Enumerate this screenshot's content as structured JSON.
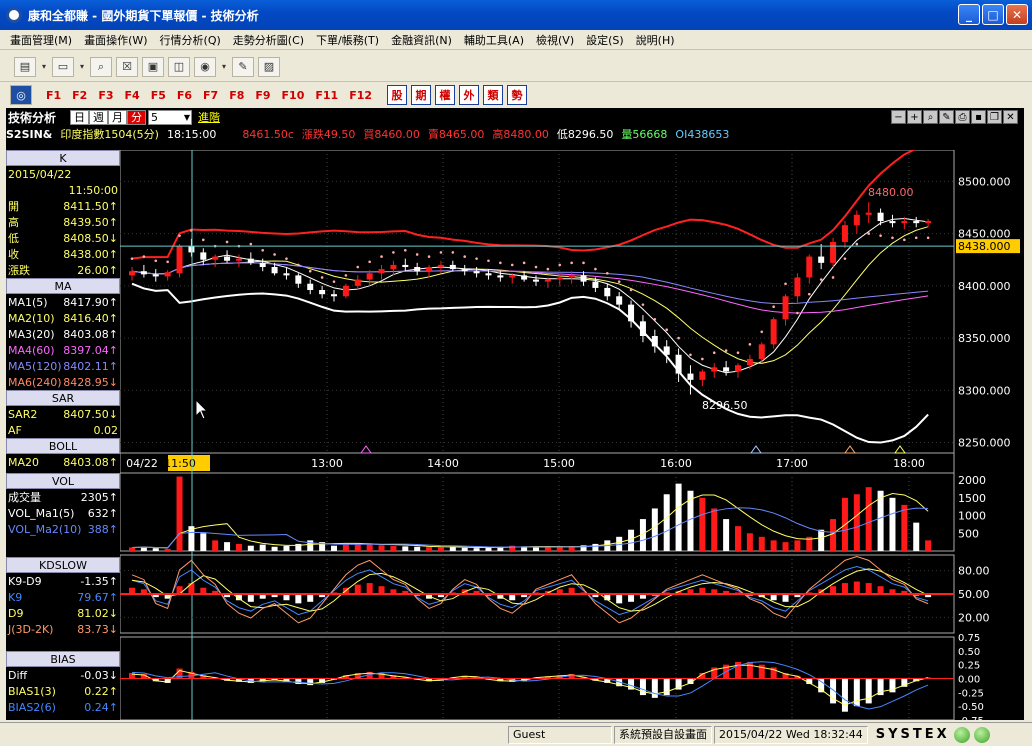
{
  "window": {
    "title": "康和全都賺 - 國外期貨下單報價 - 技術分析",
    "min": "_",
    "max": "□",
    "close": "✕"
  },
  "menu": [
    "畫面管理(M)",
    "畫面操作(W)",
    "行情分析(Q)",
    "走勢分析圖(C)",
    "下單/帳務(T)",
    "金融資訊(N)",
    "輔助工具(A)",
    "檢視(V)",
    "設定(S)",
    "說明(H)"
  ],
  "fkeys": [
    "F1",
    "F2",
    "F3",
    "F4",
    "F5",
    "F6",
    "F7",
    "F8",
    "F9",
    "F10",
    "F11",
    "F12"
  ],
  "categories": [
    "股",
    "期",
    "權",
    "外",
    "類",
    "勢"
  ],
  "chart_header": {
    "title": "技術分析",
    "periods": [
      "日",
      "週",
      "月",
      "分"
    ],
    "selected_period": "分",
    "interval": "5",
    "advanced": "進階"
  },
  "quote": {
    "symbol": "S2SIN&",
    "name": "印度指數1504(5分)",
    "time": "18:15:00",
    "last": "8461.50c",
    "change": "漲跌49.50",
    "bid": "買8460.00",
    "ask": "賣8465.00",
    "high": "高8480.00",
    "low": "低8296.50",
    "volume": "量56668",
    "oi": "OI438653"
  },
  "left": {
    "k": {
      "label": "K",
      "date": "2015/04/22",
      "time": "11:50:00",
      "rows": [
        {
          "n": "開",
          "v": "8411.50↑"
        },
        {
          "n": "高",
          "v": "8439.50↑"
        },
        {
          "n": "低",
          "v": "8408.50↓"
        },
        {
          "n": "收",
          "v": "8438.00↑"
        },
        {
          "n": "漲跌",
          "v": "26.00↑"
        }
      ]
    },
    "ma": {
      "label": "MA",
      "rows": [
        {
          "n": "MA1(5)",
          "v": "8417.90↑",
          "c": "#ffffff"
        },
        {
          "n": "MA2(10)",
          "v": "8416.40↑",
          "c": "#ffff66"
        },
        {
          "n": "MA3(20)",
          "v": "8403.08↑",
          "c": "#ffffff"
        },
        {
          "n": "MA4(60)",
          "v": "8397.04↑",
          "c": "#ff66ff"
        },
        {
          "n": "MA5(120)",
          "v": "8402.11↑",
          "c": "#8888ff"
        },
        {
          "n": "MA6(240)",
          "v": "8428.95↓",
          "c": "#ff8866"
        }
      ]
    },
    "sar": {
      "label": "SAR",
      "rows": [
        {
          "n": "SAR2",
          "v": "8407.50↓"
        },
        {
          "n": "AF",
          "v": "0.02"
        }
      ]
    },
    "boll": {
      "label": "BOLL",
      "rows": [
        {
          "n": "MA20",
          "v": "8403.08↑"
        }
      ]
    },
    "vol": {
      "label": "VOL",
      "rows": [
        {
          "n": "成交量",
          "v": "2305↑",
          "c": "#ffffff"
        },
        {
          "n": "VOL_Ma1(5)",
          "v": "632↑",
          "c": "#ffffff"
        },
        {
          "n": "VOL_Ma2(10)",
          "v": "388↑",
          "c": "#6688ff"
        }
      ]
    },
    "kd": {
      "label": "KDSLOW",
      "rows": [
        {
          "n": "K9-D9",
          "v": "-1.35↑",
          "c": "#ffffff"
        },
        {
          "n": "K9",
          "v": "79.67↑",
          "c": "#4488ff"
        },
        {
          "n": "D9",
          "v": "81.02↓",
          "c": "#ffff66"
        },
        {
          "n": "J(3D-2K)",
          "v": "83.73↓",
          "c": "#ff9966"
        }
      ]
    },
    "bias": {
      "label": "BIAS",
      "rows": [
        {
          "n": "Diff",
          "v": "-0.03↓",
          "c": "#ffffff"
        },
        {
          "n": "BIAS1(3)",
          "v": "0.22↑",
          "c": "#ffff66"
        },
        {
          "n": "BIAS2(6)",
          "v": "0.24↑",
          "c": "#4488ff"
        }
      ]
    }
  },
  "price_axis": [
    "8500.000",
    "8450.000",
    "8400.000",
    "8350.000",
    "8300.000",
    "8250.000"
  ],
  "price_current": "8438.000",
  "time_axis": [
    "04/22",
    "11:50",
    "13:00",
    "14:00",
    "15:00",
    "16:00",
    "17:00",
    "18:00"
  ],
  "annotations": {
    "high": "8480.00",
    "low": "8296.50"
  },
  "vol_axis": [
    "2000",
    "1500",
    "1000",
    "500"
  ],
  "kd_axis": [
    "80.00",
    "50.00",
    "20.00"
  ],
  "bias_axis": [
    "0.75",
    "0.50",
    "0.25",
    "0.00",
    "-0.25",
    "-0.50",
    "-0.75"
  ],
  "status": {
    "user": "Guest",
    "layout": "系統預設自設畫面",
    "datetime": "2015/04/22 Wed 18:32:44",
    "brand": "SYSTEX"
  },
  "colors": {
    "up": "#ff1a1a",
    "down": "#ffffff",
    "bg": "#000000",
    "grid": "#555555",
    "accent": "#ffcc00"
  },
  "chart_data": [
    {
      "type": "candlestick",
      "title": "印度指數1504(5分)",
      "ylim": [
        8240,
        8530
      ],
      "ohlc": [
        [
          8410,
          8418,
          8405,
          8414
        ],
        [
          8414,
          8420,
          8408,
          8411
        ],
        [
          8411,
          8416,
          8404,
          8409
        ],
        [
          8409,
          8415,
          8405,
          8413
        ],
        [
          8412,
          8440,
          8408,
          8438
        ],
        [
          8438,
          8445,
          8428,
          8432
        ],
        [
          8432,
          8436,
          8420,
          8425
        ],
        [
          8425,
          8430,
          8418,
          8428
        ],
        [
          8428,
          8434,
          8422,
          8424
        ],
        [
          8424,
          8430,
          8418,
          8426
        ],
        [
          8426,
          8432,
          8420,
          8422
        ],
        [
          8422,
          8426,
          8414,
          8418
        ],
        [
          8418,
          8422,
          8410,
          8412
        ],
        [
          8412,
          8418,
          8406,
          8410
        ],
        [
          8410,
          8412,
          8398,
          8402
        ],
        [
          8402,
          8406,
          8392,
          8396
        ],
        [
          8396,
          8400,
          8388,
          8392
        ],
        [
          8392,
          8396,
          8385,
          8390
        ],
        [
          8390,
          8402,
          8388,
          8400
        ],
        [
          8400,
          8410,
          8396,
          8406
        ],
        [
          8406,
          8415,
          8400,
          8412
        ],
        [
          8412,
          8420,
          8406,
          8416
        ],
        [
          8416,
          8424,
          8410,
          8420
        ],
        [
          8420,
          8426,
          8414,
          8418
        ],
        [
          8418,
          8422,
          8410,
          8414
        ],
        [
          8414,
          8420,
          8408,
          8418
        ],
        [
          8418,
          8424,
          8412,
          8420
        ],
        [
          8420,
          8424,
          8414,
          8416
        ],
        [
          8416,
          8420,
          8410,
          8414
        ],
        [
          8414,
          8418,
          8408,
          8412
        ],
        [
          8412,
          8416,
          8406,
          8410
        ],
        [
          8410,
          8414,
          8404,
          8408
        ],
        [
          8408,
          8412,
          8402,
          8410
        ],
        [
          8410,
          8414,
          8404,
          8406
        ],
        [
          8406,
          8410,
          8400,
          8404
        ],
        [
          8404,
          8408,
          8398,
          8406
        ],
        [
          8406,
          8412,
          8400,
          8408
        ],
        [
          8408,
          8414,
          8402,
          8410
        ],
        [
          8410,
          8414,
          8400,
          8404
        ],
        [
          8404,
          8408,
          8394,
          8398
        ],
        [
          8398,
          8402,
          8386,
          8390
        ],
        [
          8390,
          8394,
          8378,
          8382
        ],
        [
          8382,
          8386,
          8360,
          8366
        ],
        [
          8366,
          8372,
          8346,
          8352
        ],
        [
          8352,
          8358,
          8336,
          8342
        ],
        [
          8342,
          8348,
          8326,
          8334
        ],
        [
          8334,
          8340,
          8308,
          8316
        ],
        [
          8316,
          8324,
          8296,
          8310
        ],
        [
          8310,
          8320,
          8304,
          8318
        ],
        [
          8318,
          8326,
          8312,
          8322
        ],
        [
          8322,
          8328,
          8314,
          8318
        ],
        [
          8318,
          8326,
          8312,
          8324
        ],
        [
          8324,
          8334,
          8320,
          8330
        ],
        [
          8330,
          8346,
          8326,
          8344
        ],
        [
          8344,
          8370,
          8340,
          8368
        ],
        [
          8368,
          8392,
          8362,
          8390
        ],
        [
          8390,
          8412,
          8384,
          8408
        ],
        [
          8408,
          8430,
          8402,
          8428
        ],
        [
          8428,
          8440,
          8416,
          8422
        ],
        [
          8422,
          8446,
          8418,
          8442
        ],
        [
          8442,
          8462,
          8436,
          8458
        ],
        [
          8458,
          8472,
          8450,
          8468
        ],
        [
          8468,
          8480,
          8460,
          8470
        ],
        [
          8470,
          8474,
          8458,
          8462
        ],
        [
          8462,
          8468,
          8456,
          8460
        ],
        [
          8460,
          8466,
          8454,
          8462
        ],
        [
          8462,
          8466,
          8456,
          8460
        ],
        [
          8460,
          8464,
          8456,
          8462
        ]
      ]
    },
    {
      "type": "bar",
      "title": "VOL",
      "ylim": [
        0,
        2200
      ],
      "values": [
        100,
        120,
        80,
        60,
        2100,
        700,
        500,
        300,
        250,
        200,
        150,
        180,
        120,
        140,
        200,
        300,
        250,
        150,
        180,
        200,
        220,
        160,
        140,
        130,
        120,
        110,
        100,
        120,
        90,
        80,
        100,
        120,
        150,
        130,
        110,
        100,
        120,
        140,
        160,
        200,
        300,
        400,
        600,
        900,
        1200,
        1600,
        1900,
        1700,
        1500,
        1200,
        900,
        700,
        500,
        400,
        300,
        250,
        300,
        400,
        600,
        900,
        1500,
        1600,
        1800,
        1700,
        1500,
        1300,
        800,
        300
      ]
    },
    {
      "type": "bar",
      "title": "KDSLOW",
      "ylim": [
        0,
        100
      ],
      "values": [
        8,
        6,
        -4,
        -6,
        10,
        14,
        8,
        4,
        -4,
        -8,
        -10,
        -6,
        -4,
        -8,
        -12,
        -10,
        -4,
        2,
        8,
        12,
        14,
        10,
        6,
        4,
        -2,
        -6,
        -4,
        2,
        6,
        4,
        -2,
        -6,
        -8,
        -4,
        2,
        4,
        6,
        8,
        2,
        -4,
        -8,
        -12,
        -10,
        -6,
        -2,
        2,
        4,
        6,
        8,
        6,
        4,
        2,
        -2,
        -4,
        -8,
        -10,
        -4,
        2,
        6,
        10,
        14,
        16,
        14,
        10,
        6,
        4,
        -2,
        -4
      ]
    },
    {
      "type": "bar",
      "title": "BIAS",
      "ylim": [
        -0.75,
        0.75
      ],
      "values": [
        0.1,
        0.08,
        -0.05,
        -0.08,
        0.18,
        0.12,
        0.06,
        0.02,
        -0.04,
        -0.06,
        -0.08,
        -0.05,
        -0.03,
        -0.06,
        -0.1,
        -0.12,
        -0.08,
        -0.02,
        0.06,
        0.1,
        0.12,
        0.1,
        0.06,
        0.03,
        -0.02,
        -0.05,
        -0.04,
        0.02,
        0.05,
        0.04,
        -0.02,
        -0.05,
        -0.06,
        -0.04,
        0.02,
        0.04,
        0.06,
        0.08,
        0.03,
        -0.04,
        -0.08,
        -0.14,
        -0.2,
        -0.3,
        -0.35,
        -0.3,
        -0.2,
        -0.1,
        0.1,
        0.2,
        0.25,
        0.3,
        0.3,
        0.25,
        0.2,
        0.1,
        0.05,
        -0.1,
        -0.25,
        -0.45,
        -0.6,
        -0.5,
        -0.45,
        -0.3,
        -0.25,
        -0.15,
        -0.05,
        0.02
      ]
    }
  ]
}
